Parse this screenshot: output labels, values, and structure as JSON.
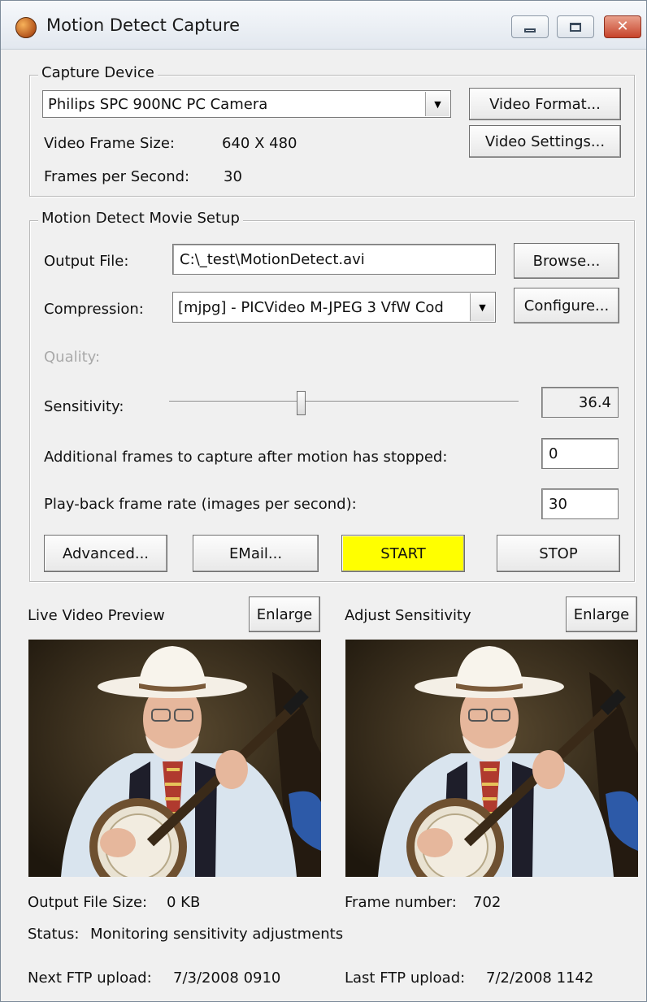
{
  "window": {
    "title": "Motion Detect Capture"
  },
  "capture_device": {
    "group_label": "Capture Device",
    "device_selected": "Philips SPC 900NC PC Camera",
    "video_format_button": "Video Format...",
    "video_settings_button": "Video Settings...",
    "frame_size_label": "Video Frame Size:",
    "frame_size_value": "640 X 480",
    "fps_label": "Frames per Second:",
    "fps_value": "30"
  },
  "movie_setup": {
    "group_label": "Motion Detect Movie Setup",
    "output_file_label": "Output File:",
    "output_file_value": "C:\\_test\\MotionDetect.avi",
    "browse_button": "Browse...",
    "compression_label": "Compression:",
    "compression_selected": "[mjpg] - PICVideo M-JPEG 3 VfW Cod",
    "configure_button": "Configure...",
    "quality_label": "Quality:",
    "sensitivity_label": "Sensitivity:",
    "sensitivity_value": "36.4",
    "sensitivity_fraction": 0.364,
    "additional_frames_label": "Additional frames to capture after motion has stopped:",
    "additional_frames_value": "0",
    "playback_rate_label": "Play-back frame rate (images per second):",
    "playback_rate_value": "30",
    "advanced_button": "Advanced...",
    "email_button": "EMail...",
    "start_button": "START",
    "stop_button": "STOP",
    "start_color": "#ffff00"
  },
  "previews": {
    "live_label": "Live Video Preview",
    "live_enlarge": "Enlarge",
    "adjust_label": "Adjust Sensitivity",
    "adjust_enlarge": "Enlarge"
  },
  "status": {
    "output_size_label": "Output File Size:",
    "output_size_value": "0 KB",
    "frame_number_label": "Frame number:",
    "frame_number_value": "702",
    "status_label": "Status:",
    "status_value": "Monitoring sensitivity adjustments",
    "next_ftp_label": "Next FTP upload:",
    "next_ftp_value": "7/3/2008 0910",
    "last_ftp_label": "Last FTP upload:",
    "last_ftp_value": "7/2/2008 1142"
  }
}
